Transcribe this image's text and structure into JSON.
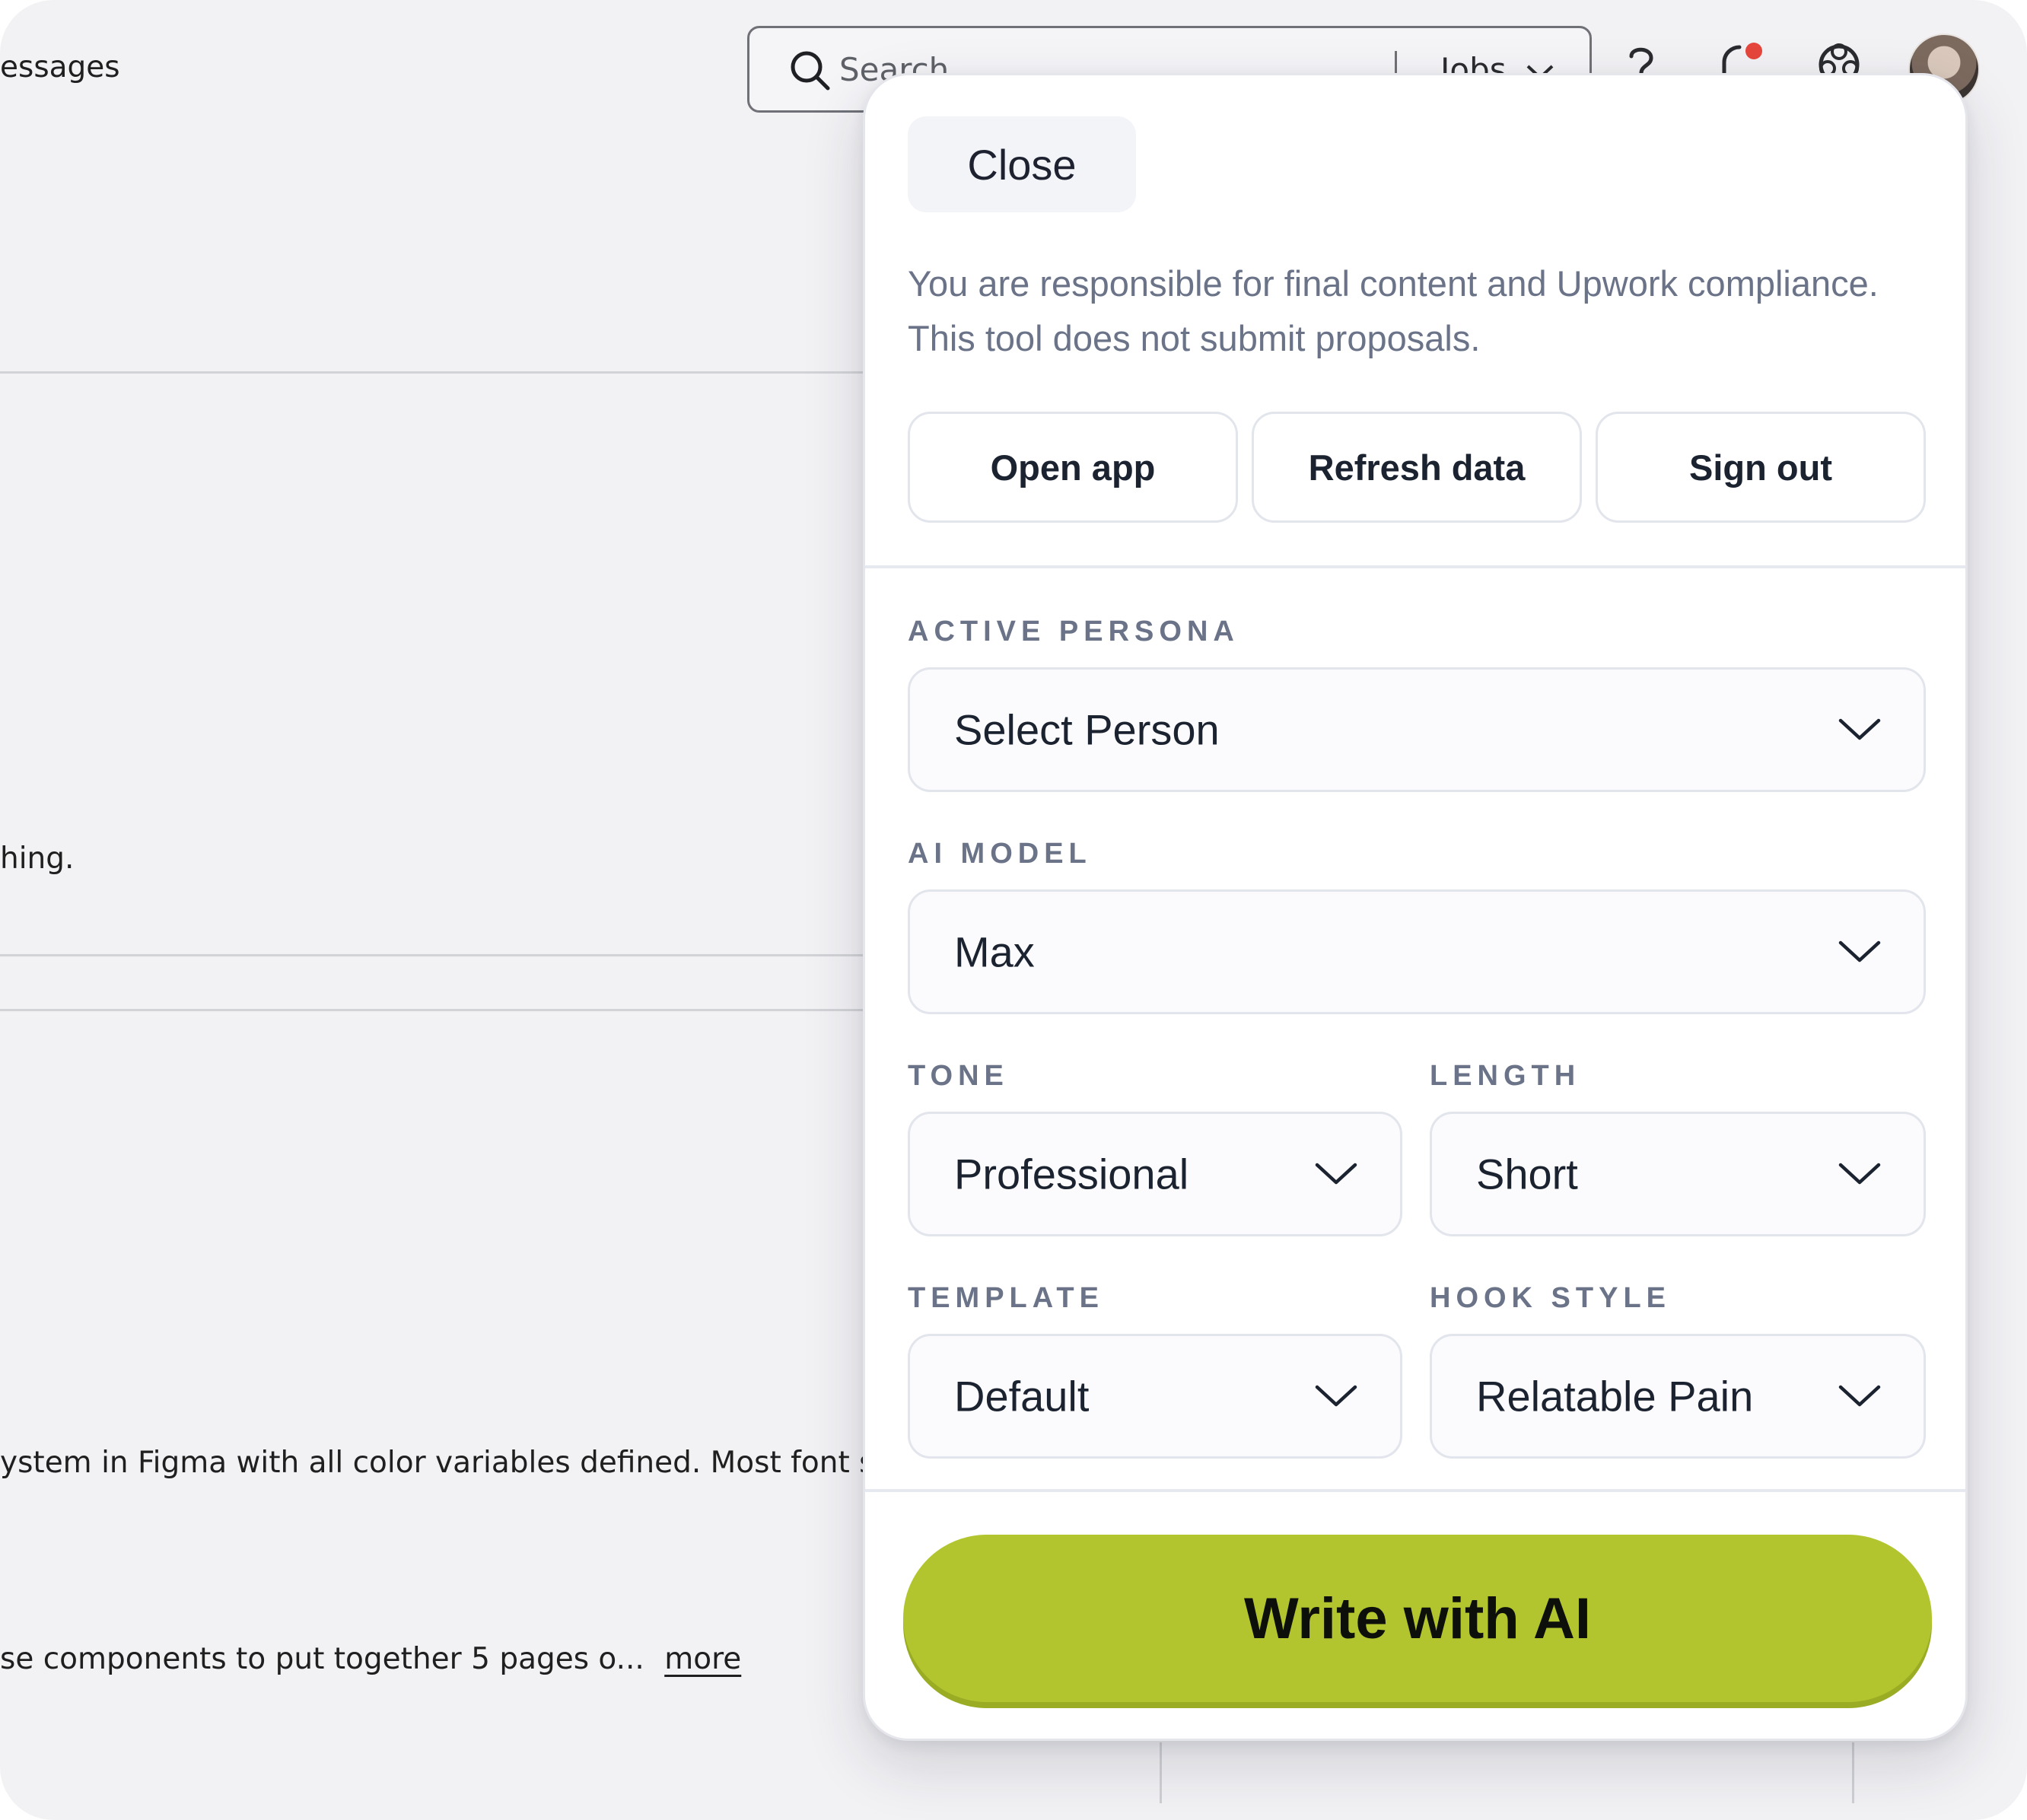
{
  "background": {
    "nav_messages": "essages",
    "snippet_truncated": "hing.",
    "job_desc_line1": "ystem in Figma with all color variables defined. Most font style",
    "job_desc_line2": "se components to put together 5 pages o...",
    "more_link": "more",
    "search": {
      "placeholder": "Search",
      "scope": "Jobs",
      "icon": "search-icon",
      "scope_icon": "chevron-down-icon"
    },
    "top_icons": [
      "help-icon",
      "notifications-icon",
      "apps-icon",
      "avatar"
    ],
    "notification_dot_color": "#e6463b"
  },
  "panel": {
    "close_label": "Close",
    "disclaimer": "You are responsible for final content and Upwork compliance. This tool does not submit proposals.",
    "actions": {
      "open_app": "Open app",
      "refresh_data": "Refresh data",
      "sign_out": "Sign out"
    },
    "fields": {
      "persona": {
        "label": "ACTIVE PERSONA",
        "value": "Select Person"
      },
      "model": {
        "label": "AI MODEL",
        "value": "Max"
      },
      "tone": {
        "label": "TONE",
        "value": "Professional"
      },
      "length": {
        "label": "LENGTH",
        "value": "Short"
      },
      "template": {
        "label": "TEMPLATE",
        "value": "Default"
      },
      "hook_style": {
        "label": "HOOK STYLE",
        "value": "Relatable Pain"
      }
    },
    "write_button": "Write with AI",
    "accent_color": "#b2c52e"
  }
}
